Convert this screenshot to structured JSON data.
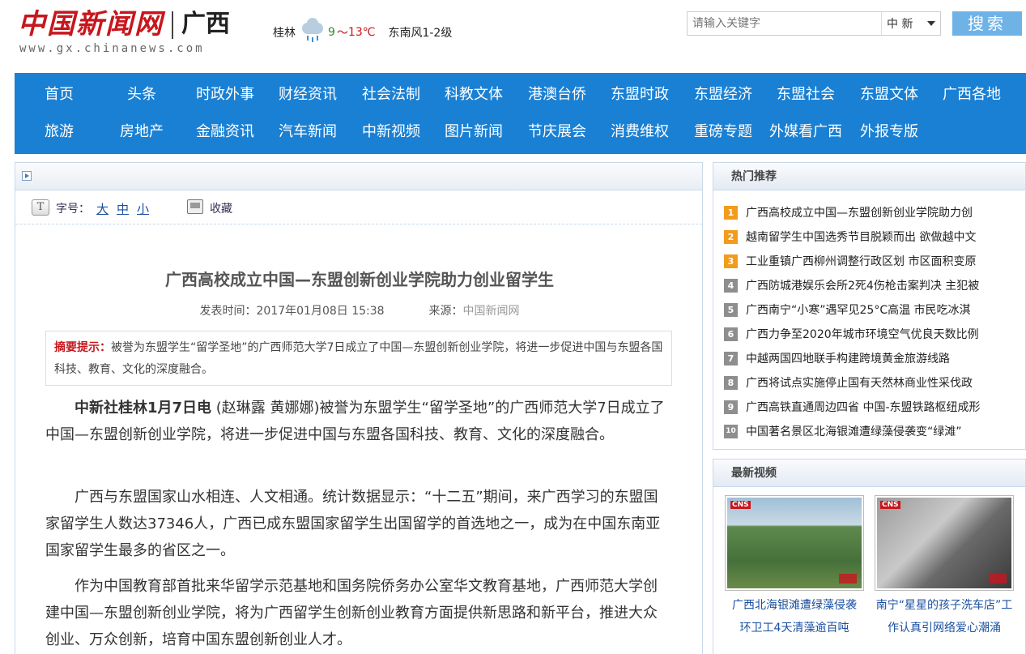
{
  "header": {
    "logo_cn": "中国新闻网",
    "region": "广西",
    "url": "www.gx.chinanews.com",
    "weather": {
      "city": "桂林",
      "icon": "rain-cloud-icon",
      "temp_low": "9",
      "sep": "～",
      "temp_high": "13℃",
      "wind": "东南风1-2级"
    },
    "search": {
      "placeholder": "请输入关键字",
      "select_value": "中 新",
      "button_label": "搜索"
    }
  },
  "nav": {
    "row1": [
      "首页",
      "头条",
      "时政外事",
      "财经资讯",
      "社会法制",
      "科教文体",
      "港澳台侨",
      "东盟时政",
      "东盟经济",
      "东盟社会",
      "东盟文体",
      "广西各地"
    ],
    "row2": [
      "旅游",
      "房地产",
      "金融资讯",
      "汽车新闻",
      "中新视频",
      "图片新闻",
      "节庆展会",
      "消费维权",
      "重磅专题",
      "外媒看广西",
      "外报专版"
    ]
  },
  "toolbar": {
    "font_label": "字号：",
    "font_big": "大",
    "font_mid": "中",
    "font_small": "小",
    "favorite": "收藏"
  },
  "article": {
    "title": "广西高校成立中国—东盟创新创业学院助力创业留学生",
    "time_label": "发表时间：",
    "time": "2017年01月08日 15:38",
    "source_label": "来源：",
    "source": "中国新闻网",
    "summary_label": "摘要提示：",
    "summary": "被誉为东盟学生“留学圣地”的广西师范大学7日成立了中国—东盟创新创业学院，将进一步促进中国与东盟各国科技、教育、文化的深度融合。",
    "p1_lead": "中新社桂林1月7日电",
    "p1_rest": " (赵琳露 黄娜娜)被誉为东盟学生“留学圣地”的广西师范大学7日成立了中国—东盟创新创业学院，将进一步促进中国与东盟各国科技、教育、文化的深度融合。",
    "p2": "广西与东盟国家山水相连、人文相通。统计数据显示：“十二五”期间，来广西学习的东盟国家留学生人数达37346人，广西已成东盟国家留学生出国留学的首选地之一，成为在中国东南亚国家留学生最多的省区之一。",
    "p3": "作为中国教育部首批来华留学示范基地和国务院侨务办公室华文教育基地，广西师范大学创建中国—东盟创新创业学院，将为广西留学生创新创业教育方面提供新思路和新平台，推进大众创业、万众创新，培育中国东盟创新创业人才。"
  },
  "hot": {
    "title": "热门推荐",
    "items": [
      {
        "rank": "1",
        "text": "广西高校成立中国—东盟创新创业学院助力创"
      },
      {
        "rank": "2",
        "text": "越南留学生中国选秀节目脱颖而出 欲做越中文"
      },
      {
        "rank": "3",
        "text": "工业重镇广西柳州调整行政区划 市区面积变原"
      },
      {
        "rank": "4",
        "text": "广西防城港娱乐会所2死4伤枪击案判决 主犯被"
      },
      {
        "rank": "5",
        "text": "广西南宁“小寒”遇罕见25°C高温 市民吃冰淇"
      },
      {
        "rank": "6",
        "text": "广西力争至2020年城市环境空气优良天数比例"
      },
      {
        "rank": "7",
        "text": "中越两国四地联手构建跨境黄金旅游线路"
      },
      {
        "rank": "8",
        "text": "广西将试点实施停止国有天然林商业性采伐政"
      },
      {
        "rank": "9",
        "text": "广西高铁直通周边四省 中国-东盟铁路枢纽成形"
      },
      {
        "rank": "10",
        "text": "中国著名景区北海银滩遭绿藻侵袭变“绿滩”"
      }
    ]
  },
  "video": {
    "title": "最新视频",
    "items": [
      {
        "caption": "广西北海银滩遭绿藻侵袭 环卫工4天清藻逾百吨",
        "mark": "CNS"
      },
      {
        "caption": "南宁“星星的孩子洗车店”工作认真引网络爱心潮涌",
        "mark": "CNS"
      }
    ]
  }
}
